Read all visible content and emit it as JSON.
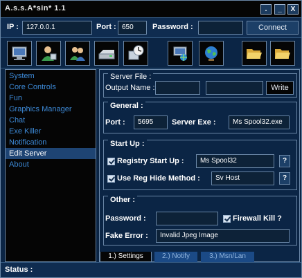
{
  "window": {
    "title": "A.s.s.A*sin* 1.1",
    "buttons": [
      ".",
      "_",
      "X"
    ]
  },
  "connection": {
    "ip_label": "IP :",
    "ip_value": "127.0.0.1",
    "port_label": "Port :",
    "port_value": "650",
    "password_label": "Password :",
    "password_value": "",
    "connect_label": "Connect"
  },
  "toolbar": {
    "icons": [
      "computer-icon",
      "user-icon",
      "users-icon",
      "drive-icon",
      "clock-icon",
      "network-icon",
      "globe-icon",
      "folder-open-icon",
      "folder-open-icon"
    ]
  },
  "sidebar": {
    "items": [
      {
        "label": "System"
      },
      {
        "label": "Core Controls"
      },
      {
        "label": "Fun"
      },
      {
        "label": "Graphics Manager"
      },
      {
        "label": "Chat"
      },
      {
        "label": "Exe Killer"
      },
      {
        "label": "Notification"
      },
      {
        "label": "Edit Server",
        "active": true
      },
      {
        "label": "About"
      }
    ]
  },
  "server_file": {
    "title": "Server File :",
    "output_label": "Output Name :",
    "field1": "",
    "field2": "",
    "write_label": "Write"
  },
  "general": {
    "title": "General :",
    "port_label": "Port :",
    "port_value": "5695",
    "exe_label": "Server Exe :",
    "exe_value": "Ms Spool32.exe"
  },
  "startup": {
    "title": "Start Up :",
    "registry_label": "Registry Start Up :",
    "registry_checked": true,
    "registry_value": "Ms Spool32",
    "hide_label": "Use Reg Hide Method :",
    "hide_checked": true,
    "hide_value": "Sv Host",
    "help_label": "?"
  },
  "other": {
    "title": "Other :",
    "password_label": "Password :",
    "password_value": "",
    "firewall_label": "Firewall Kill ?",
    "firewall_checked": true,
    "fake_error_label": "Fake Error :",
    "fake_error_value": "Invalid Jpeg Image"
  },
  "tabs": [
    {
      "label": "1.) Settings",
      "active": true
    },
    {
      "label": "2.) Notify",
      "active": false
    },
    {
      "label": "3.) Msn/Lan",
      "active": false
    }
  ],
  "status": {
    "label": "Status :"
  }
}
